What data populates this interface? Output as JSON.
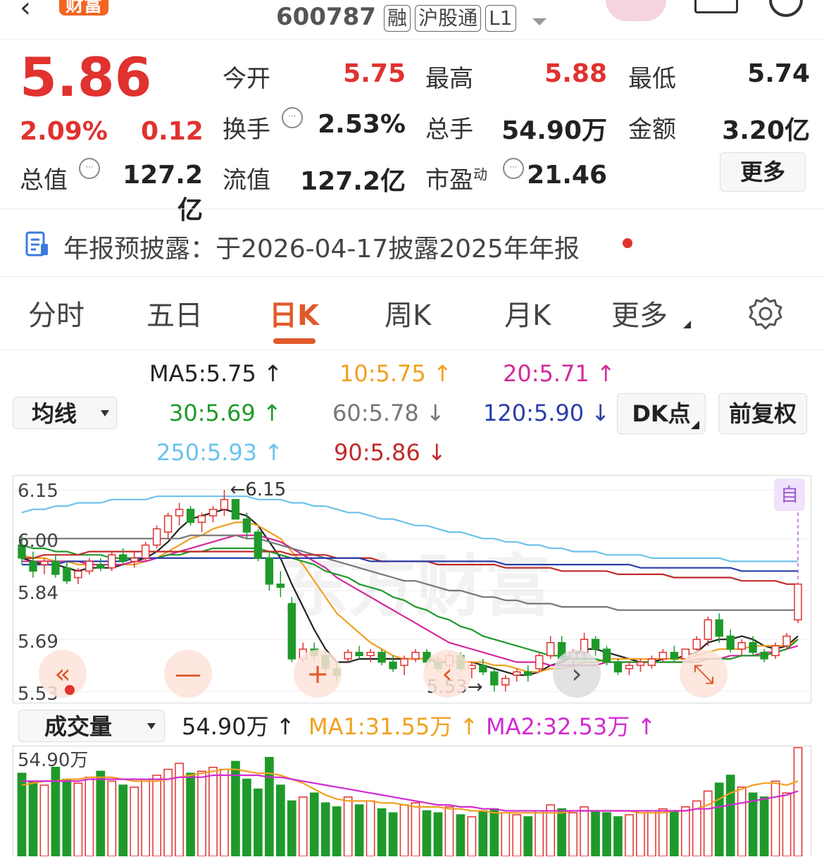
{
  "header": {
    "badge": "财富",
    "code": "600787",
    "tags": [
      "融",
      "沪股通",
      "L1"
    ]
  },
  "quote": {
    "price": "5.86",
    "change_pct": "2.09%",
    "change_amt": "0.12",
    "fields": [
      {
        "label": "今开",
        "value": "5.75",
        "color": "red"
      },
      {
        "label": "最高",
        "value": "5.88",
        "color": "red"
      },
      {
        "label": "最低",
        "value": "5.74",
        "color": "black"
      },
      {
        "label": "换手",
        "value": "2.53%",
        "color": "black"
      },
      {
        "label": "总手",
        "value": "54.90万",
        "color": "black"
      },
      {
        "label": "金额",
        "value": "3.20亿",
        "color": "black"
      },
      {
        "label": "总值",
        "value": "127.2亿",
        "color": "black"
      },
      {
        "label": "流值",
        "value": "127.2亿",
        "color": "black"
      },
      {
        "label": "市盈",
        "label_sup": "动",
        "value": "21.46",
        "color": "black"
      }
    ],
    "more_button": "更多"
  },
  "notice": {
    "text": "年报预披露：于2026-04-17披露2025年年报"
  },
  "tabs": [
    "分时",
    "五日",
    "日K",
    "周K",
    "月K",
    "更多"
  ],
  "active_tab": "日K",
  "indicator": {
    "selector": "均线",
    "ma": [
      {
        "text": "MA5:5.75",
        "arrow": "↑",
        "color": "#222222"
      },
      {
        "text": "10:5.75",
        "arrow": "↑",
        "color": "#f0a020"
      },
      {
        "text": "20:5.71",
        "arrow": "↑",
        "color": "#d22a9c"
      },
      {
        "text": "30:5.69",
        "arrow": "↑",
        "color": "#1f9a2a"
      },
      {
        "text": "60:5.78",
        "arrow": "↓",
        "color": "#777777"
      },
      {
        "text": "120:5.90",
        "arrow": "↓",
        "color": "#2a3ea8"
      },
      {
        "text": "250:5.93",
        "arrow": "↑",
        "color": "#6cc2ec"
      },
      {
        "text": "90:5.86",
        "arrow": "↓",
        "color": "#c22a2a"
      }
    ],
    "dk_button": "DK点",
    "adjust_button": "前复权"
  },
  "kline": {
    "y_ticks": [
      "6.15",
      "6.00",
      "5.84",
      "5.69",
      "5.53"
    ],
    "high_label": "←6.15",
    "low_label": "5.53→",
    "auto_badge": "自",
    "watermark": "东方财富"
  },
  "volume": {
    "selector": "成交量",
    "value": "54.90万",
    "value_arrow": "↑",
    "ma1": "MA1:31.55万",
    "ma1_arrow": "↑",
    "ma2": "MA2:32.53万",
    "ma2_arrow": "↑",
    "top_label": "54.90万"
  },
  "chart_data": {
    "type": "candlestick",
    "ylim": [
      5.53,
      6.15
    ],
    "ohlc": [
      [
        5.98,
        6.01,
        5.92,
        5.94
      ],
      [
        5.93,
        5.96,
        5.88,
        5.9
      ],
      [
        5.92,
        5.94,
        5.89,
        5.93
      ],
      [
        5.93,
        5.95,
        5.88,
        5.89
      ],
      [
        5.91,
        5.93,
        5.86,
        5.87
      ],
      [
        5.88,
        5.91,
        5.86,
        5.9
      ],
      [
        5.9,
        5.94,
        5.89,
        5.93
      ],
      [
        5.92,
        5.94,
        5.9,
        5.91
      ],
      [
        5.91,
        5.96,
        5.9,
        5.95
      ],
      [
        5.95,
        5.97,
        5.92,
        5.93
      ],
      [
        5.93,
        5.96,
        5.91,
        5.94
      ],
      [
        5.94,
        5.99,
        5.93,
        5.98
      ],
      [
        5.98,
        6.04,
        5.97,
        6.03
      ],
      [
        6.02,
        6.08,
        6.0,
        6.07
      ],
      [
        6.07,
        6.11,
        6.04,
        6.09
      ],
      [
        6.09,
        6.1,
        6.04,
        6.05
      ],
      [
        6.05,
        6.08,
        6.02,
        6.07
      ],
      [
        6.07,
        6.1,
        6.05,
        6.09
      ],
      [
        6.09,
        6.15,
        6.07,
        6.12
      ],
      [
        6.12,
        6.12,
        6.06,
        6.06
      ],
      [
        6.06,
        6.08,
        6.0,
        6.02
      ],
      [
        6.02,
        6.03,
        5.93,
        5.94
      ],
      [
        5.94,
        5.96,
        5.84,
        5.86
      ],
      [
        5.86,
        5.9,
        5.82,
        5.85
      ],
      [
        5.8,
        5.82,
        5.62,
        5.63
      ],
      [
        5.63,
        5.68,
        5.62,
        5.66
      ],
      [
        5.66,
        5.68,
        5.62,
        5.64
      ],
      [
        5.64,
        5.65,
        5.58,
        5.6
      ],
      [
        5.6,
        5.62,
        5.56,
        5.58
      ],
      [
        5.63,
        5.66,
        5.62,
        5.65
      ],
      [
        5.65,
        5.67,
        5.63,
        5.64
      ],
      [
        5.64,
        5.66,
        5.62,
        5.65
      ],
      [
        5.65,
        5.66,
        5.61,
        5.62
      ],
      [
        5.62,
        5.64,
        5.59,
        5.6
      ],
      [
        5.61,
        5.64,
        5.58,
        5.63
      ],
      [
        5.63,
        5.66,
        5.62,
        5.65
      ],
      [
        5.65,
        5.66,
        5.61,
        5.62
      ],
      [
        5.62,
        5.64,
        5.59,
        5.6
      ],
      [
        5.61,
        5.65,
        5.6,
        5.64
      ],
      [
        5.64,
        5.65,
        5.59,
        5.6
      ],
      [
        5.6,
        5.62,
        5.57,
        5.61
      ],
      [
        5.61,
        5.63,
        5.58,
        5.59
      ],
      [
        5.59,
        5.6,
        5.53,
        5.55
      ],
      [
        5.55,
        5.58,
        5.53,
        5.57
      ],
      [
        5.58,
        5.6,
        5.56,
        5.59
      ],
      [
        5.59,
        5.61,
        5.56,
        5.58
      ],
      [
        5.6,
        5.65,
        5.59,
        5.64
      ],
      [
        5.64,
        5.7,
        5.63,
        5.68
      ],
      [
        5.68,
        5.7,
        5.62,
        5.63
      ],
      [
        5.63,
        5.66,
        5.6,
        5.65
      ],
      [
        5.65,
        5.71,
        5.63,
        5.69
      ],
      [
        5.69,
        5.7,
        5.64,
        5.66
      ],
      [
        5.66,
        5.67,
        5.61,
        5.62
      ],
      [
        5.62,
        5.63,
        5.58,
        5.59
      ],
      [
        5.6,
        5.62,
        5.58,
        5.61
      ],
      [
        5.61,
        5.63,
        5.59,
        5.62
      ],
      [
        5.61,
        5.64,
        5.6,
        5.63
      ],
      [
        5.63,
        5.66,
        5.62,
        5.65
      ],
      [
        5.65,
        5.67,
        5.62,
        5.63
      ],
      [
        5.63,
        5.66,
        5.62,
        5.66
      ],
      [
        5.66,
        5.7,
        5.64,
        5.69
      ],
      [
        5.69,
        5.76,
        5.67,
        5.75
      ],
      [
        5.75,
        5.77,
        5.68,
        5.7
      ],
      [
        5.7,
        5.72,
        5.65,
        5.66
      ],
      [
        5.66,
        5.69,
        5.64,
        5.68
      ],
      [
        5.68,
        5.7,
        5.64,
        5.65
      ],
      [
        5.65,
        5.66,
        5.62,
        5.63
      ],
      [
        5.64,
        5.68,
        5.63,
        5.67
      ],
      [
        5.67,
        5.71,
        5.66,
        5.7
      ],
      [
        5.75,
        5.86,
        5.74,
        5.86
      ]
    ],
    "ma_lines": [
      {
        "name": "MA5",
        "color": "#222222",
        "values": [
          5.94,
          5.93,
          5.92,
          5.92,
          5.91,
          5.9,
          5.91,
          5.91,
          5.91,
          5.92,
          5.93,
          5.94,
          5.96,
          5.99,
          6.03,
          6.06,
          6.07,
          6.08,
          6.09,
          6.08,
          6.07,
          6.04,
          5.99,
          5.94,
          5.86,
          5.79,
          5.72,
          5.66,
          5.62,
          5.62,
          5.63,
          5.63,
          5.63,
          5.63,
          5.63,
          5.63,
          5.63,
          5.62,
          5.62,
          5.62,
          5.62,
          5.61,
          5.6,
          5.59,
          5.58,
          5.58,
          5.59,
          5.61,
          5.62,
          5.64,
          5.66,
          5.66,
          5.65,
          5.64,
          5.63,
          5.62,
          5.62,
          5.63,
          5.63,
          5.64,
          5.65,
          5.68,
          5.69,
          5.69,
          5.7,
          5.69,
          5.67,
          5.66,
          5.67,
          5.7
        ]
      },
      {
        "name": "MA10",
        "color": "#f0a020",
        "values": [
          5.95,
          5.94,
          5.94,
          5.93,
          5.93,
          5.92,
          5.92,
          5.92,
          5.92,
          5.92,
          5.92,
          5.93,
          5.94,
          5.96,
          5.98,
          6.0,
          6.01,
          6.03,
          6.04,
          6.05,
          6.05,
          6.04,
          6.02,
          6.0,
          5.96,
          5.92,
          5.87,
          5.82,
          5.77,
          5.74,
          5.71,
          5.68,
          5.66,
          5.64,
          5.63,
          5.63,
          5.63,
          5.63,
          5.62,
          5.62,
          5.62,
          5.62,
          5.61,
          5.61,
          5.6,
          5.59,
          5.59,
          5.6,
          5.6,
          5.61,
          5.62,
          5.62,
          5.63,
          5.63,
          5.63,
          5.63,
          5.63,
          5.63,
          5.63,
          5.63,
          5.64,
          5.65,
          5.66,
          5.66,
          5.66,
          5.67,
          5.67,
          5.67,
          5.67,
          5.69
        ]
      },
      {
        "name": "MA20",
        "color": "#d22a9c",
        "values": [
          5.93,
          5.93,
          5.93,
          5.93,
          5.93,
          5.93,
          5.92,
          5.92,
          5.92,
          5.92,
          5.93,
          5.93,
          5.94,
          5.95,
          5.96,
          5.97,
          5.98,
          5.99,
          6.0,
          6.01,
          6.01,
          6.01,
          6.0,
          5.99,
          5.97,
          5.95,
          5.93,
          5.91,
          5.88,
          5.86,
          5.84,
          5.82,
          5.8,
          5.78,
          5.76,
          5.74,
          5.72,
          5.7,
          5.68,
          5.67,
          5.66,
          5.65,
          5.64,
          5.63,
          5.62,
          5.62,
          5.62,
          5.61,
          5.61,
          5.61,
          5.61,
          5.61,
          5.62,
          5.62,
          5.62,
          5.62,
          5.62,
          5.62,
          5.62,
          5.62,
          5.63,
          5.63,
          5.63,
          5.64,
          5.64,
          5.64,
          5.65,
          5.65,
          5.66,
          5.67
        ]
      },
      {
        "name": "MA30",
        "color": "#1f9a2a",
        "values": [
          5.98,
          5.97,
          5.97,
          5.96,
          5.96,
          5.95,
          5.95,
          5.95,
          5.94,
          5.94,
          5.94,
          5.94,
          5.94,
          5.95,
          5.95,
          5.96,
          5.96,
          5.97,
          5.97,
          5.97,
          5.97,
          5.97,
          5.96,
          5.95,
          5.94,
          5.93,
          5.92,
          5.9,
          5.89,
          5.88,
          5.86,
          5.85,
          5.84,
          5.82,
          5.81,
          5.79,
          5.78,
          5.76,
          5.75,
          5.73,
          5.72,
          5.7,
          5.69,
          5.68,
          5.67,
          5.66,
          5.65,
          5.64,
          5.64,
          5.63,
          5.63,
          5.63,
          5.62,
          5.62,
          5.62,
          5.62,
          5.62,
          5.62,
          5.62,
          5.62,
          5.62,
          5.63,
          5.63,
          5.63,
          5.64,
          5.64,
          5.64,
          5.65,
          5.66,
          5.69
        ]
      },
      {
        "name": "MA60",
        "color": "#777777",
        "values": [
          6.0,
          6.0,
          6.0,
          6.0,
          6.0,
          6.0,
          6.0,
          6.0,
          6.0,
          6.0,
          6.0,
          6.0,
          6.0,
          6.0,
          6.0,
          6.01,
          6.01,
          6.01,
          6.01,
          6.01,
          6.0,
          6.0,
          5.99,
          5.98,
          5.97,
          5.96,
          5.95,
          5.94,
          5.93,
          5.92,
          5.91,
          5.9,
          5.89,
          5.88,
          5.87,
          5.87,
          5.86,
          5.85,
          5.84,
          5.84,
          5.83,
          5.82,
          5.82,
          5.81,
          5.81,
          5.8,
          5.8,
          5.8,
          5.79,
          5.79,
          5.79,
          5.79,
          5.79,
          5.78,
          5.78,
          5.78,
          5.78,
          5.78,
          5.78,
          5.78,
          5.78,
          5.78,
          5.78,
          5.78,
          5.78,
          5.78,
          5.78,
          5.78,
          5.78,
          5.78
        ]
      },
      {
        "name": "MA90",
        "color": "#c22a2a",
        "values": [
          5.94,
          5.94,
          5.95,
          5.95,
          5.95,
          5.95,
          5.96,
          5.96,
          5.96,
          5.96,
          5.96,
          5.96,
          5.96,
          5.96,
          5.96,
          5.96,
          5.96,
          5.96,
          5.96,
          5.96,
          5.96,
          5.96,
          5.96,
          5.96,
          5.95,
          5.95,
          5.95,
          5.95,
          5.94,
          5.94,
          5.94,
          5.94,
          5.93,
          5.93,
          5.93,
          5.93,
          5.93,
          5.92,
          5.92,
          5.92,
          5.92,
          5.92,
          5.92,
          5.91,
          5.91,
          5.91,
          5.91,
          5.91,
          5.9,
          5.9,
          5.9,
          5.9,
          5.9,
          5.89,
          5.89,
          5.89,
          5.89,
          5.89,
          5.88,
          5.88,
          5.88,
          5.88,
          5.88,
          5.88,
          5.87,
          5.87,
          5.87,
          5.87,
          5.86,
          5.86
        ]
      },
      {
        "name": "MA120",
        "color": "#2a3ea8",
        "values": [
          5.92,
          5.92,
          5.92,
          5.92,
          5.93,
          5.93,
          5.93,
          5.93,
          5.93,
          5.93,
          5.94,
          5.94,
          5.94,
          5.94,
          5.94,
          5.94,
          5.94,
          5.94,
          5.94,
          5.94,
          5.94,
          5.94,
          5.94,
          5.94,
          5.94,
          5.94,
          5.94,
          5.94,
          5.94,
          5.94,
          5.94,
          5.93,
          5.93,
          5.93,
          5.93,
          5.93,
          5.93,
          5.93,
          5.93,
          5.93,
          5.93,
          5.93,
          5.93,
          5.92,
          5.92,
          5.92,
          5.92,
          5.92,
          5.92,
          5.92,
          5.92,
          5.92,
          5.92,
          5.92,
          5.92,
          5.91,
          5.91,
          5.91,
          5.91,
          5.91,
          5.91,
          5.91,
          5.91,
          5.91,
          5.9,
          5.9,
          5.9,
          5.9,
          5.9,
          5.9
        ]
      },
      {
        "name": "MA250",
        "color": "#6cc2ec",
        "values": [
          6.08,
          6.09,
          6.09,
          6.1,
          6.1,
          6.11,
          6.11,
          6.11,
          6.12,
          6.12,
          6.12,
          6.12,
          6.13,
          6.13,
          6.13,
          6.13,
          6.13,
          6.13,
          6.13,
          6.13,
          6.13,
          6.12,
          6.12,
          6.12,
          6.11,
          6.11,
          6.1,
          6.1,
          6.09,
          6.08,
          6.08,
          6.07,
          6.06,
          6.06,
          6.05,
          6.04,
          6.04,
          6.03,
          6.02,
          6.02,
          6.01,
          6.0,
          6.0,
          5.99,
          5.99,
          5.98,
          5.98,
          5.97,
          5.97,
          5.96,
          5.96,
          5.96,
          5.95,
          5.95,
          5.95,
          5.95,
          5.94,
          5.94,
          5.94,
          5.94,
          5.94,
          5.94,
          5.94,
          5.93,
          5.93,
          5.93,
          5.93,
          5.93,
          5.93,
          5.93
        ]
      }
    ],
    "volume_unit": "万",
    "volume_max": 54.9,
    "volume": [
      42,
      38,
      36,
      45,
      39,
      37,
      40,
      43,
      38,
      36,
      35,
      39,
      41,
      44,
      47,
      42,
      43,
      45,
      44,
      48,
      39,
      34,
      50,
      36,
      28,
      30,
      32,
      27,
      25,
      30,
      26,
      28,
      24,
      22,
      26,
      27,
      23,
      22,
      25,
      21,
      20,
      23,
      24,
      22,
      21,
      20,
      23,
      26,
      24,
      22,
      25,
      23,
      22,
      20,
      21,
      22,
      23,
      24,
      23,
      25,
      28,
      33,
      37,
      41,
      35,
      32,
      30,
      38,
      32,
      55
    ],
    "volume_ma1": [
      36,
      37,
      38,
      38,
      39,
      39,
      40,
      40,
      40,
      39,
      38,
      38,
      38,
      39,
      40,
      41,
      42,
      43,
      44,
      44,
      43,
      42,
      42,
      41,
      39,
      37,
      34,
      31,
      29,
      28,
      28,
      28,
      27,
      27,
      26,
      25,
      25,
      25,
      24,
      24,
      23,
      23,
      22,
      22,
      22,
      22,
      22,
      22,
      22,
      23,
      23,
      23,
      23,
      23,
      23,
      22,
      22,
      22,
      23,
      23,
      24,
      26,
      29,
      32,
      34,
      36,
      37,
      37,
      36,
      38
    ],
    "volume_ma2": [
      38,
      38,
      38,
      38,
      38,
      38,
      39,
      39,
      39,
      39,
      39,
      39,
      39,
      39,
      40,
      40,
      40,
      41,
      41,
      41,
      41,
      41,
      40,
      40,
      39,
      38,
      37,
      36,
      35,
      34,
      33,
      32,
      31,
      30,
      29,
      28,
      27,
      26,
      26,
      25,
      25,
      24,
      24,
      23,
      23,
      23,
      23,
      23,
      23,
      23,
      23,
      23,
      23,
      23,
      23,
      23,
      23,
      23,
      23,
      23,
      24,
      24,
      25,
      26,
      27,
      28,
      29,
      30,
      31,
      33
    ]
  }
}
